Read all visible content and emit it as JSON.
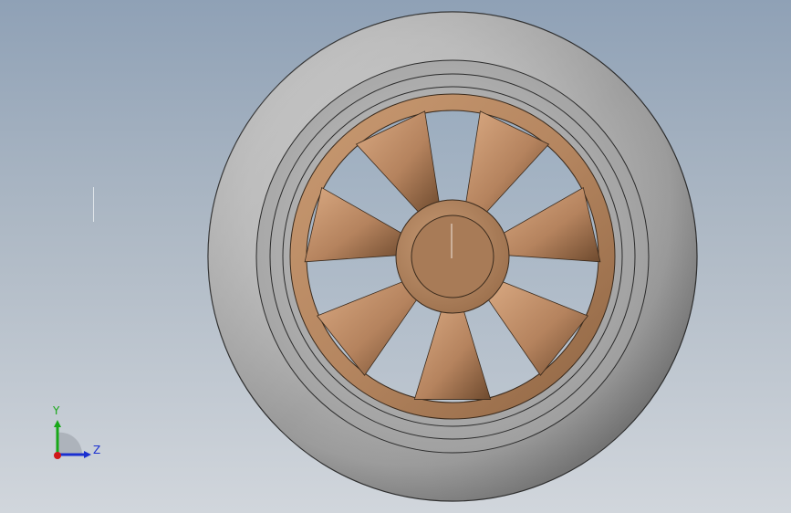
{
  "viewport": {
    "background_top": "#8fa1b6",
    "background_bottom": "#d1d6dc"
  },
  "model": {
    "tire_color": "#9a9a9a",
    "rim_color": "#b5835e",
    "spoke_count": 7
  },
  "triad": {
    "y_label": "Y",
    "z_label": "Z",
    "y_color": "#18a818",
    "z_color": "#1a2fd0",
    "x_color": "#d01818"
  }
}
